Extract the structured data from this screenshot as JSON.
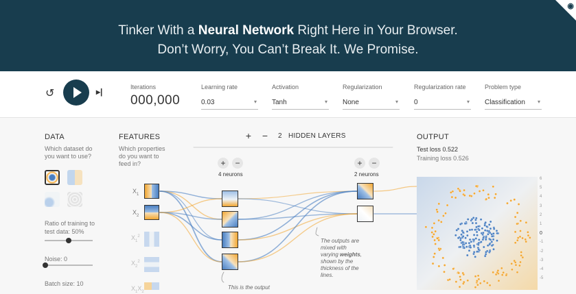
{
  "header": {
    "line1_pre": "Tinker With a ",
    "line1_bold": "Neural Network",
    "line1_post": " Right Here in Your Browser.",
    "line2": "Don’t Worry, You Can’t Break It. We Promise."
  },
  "controls": {
    "iterations_label": "Iterations",
    "iterations_value": "000,000",
    "learning_rate_label": "Learning rate",
    "learning_rate_value": "0.03",
    "activation_label": "Activation",
    "activation_value": "Tanh",
    "regularization_label": "Regularization",
    "regularization_value": "None",
    "regularization_rate_label": "Regularization rate",
    "regularization_rate_value": "0",
    "problem_type_label": "Problem type",
    "problem_type_value": "Classification"
  },
  "data_col": {
    "title": "DATA",
    "desc1": "Which dataset do",
    "desc2": "you want to use?",
    "ratio_label1": "Ratio of training to",
    "ratio_label2": "test data:  50%",
    "noise_label": "Noise:  0",
    "batch_label": "Batch size:  10",
    "ratio_value": 0.5,
    "noise_value": 0
  },
  "features_col": {
    "title": "FEATURES",
    "desc1": "Which properties",
    "desc2": "do you want to",
    "desc3": "feed in?"
  },
  "hidden": {
    "count": "2",
    "title": "HIDDEN LAYERS",
    "layer1_neurons": "4 neurons",
    "layer2_neurons": "2 neurons",
    "plus": "+",
    "minus": "−",
    "annot_weights": [
      "The outputs are",
      "mixed with",
      "varying weights,",
      "shown by the",
      "thickness of the",
      "lines."
    ],
    "annot_output": "This is the output"
  },
  "output": {
    "title": "OUTPUT",
    "test_loss": "Test loss 0.522",
    "training_loss": "Training loss 0.526",
    "ticks": [
      "6",
      "5",
      "4",
      "3",
      "2",
      "1",
      "0",
      "-1",
      "-2",
      "-3",
      "-4",
      "-5"
    ]
  },
  "colors": {
    "header_bg": "#183d4e",
    "positive": "#4a7fc1",
    "negative": "#f2a733"
  },
  "icons": {
    "reset": "reset-icon",
    "play": "play-icon",
    "step": "step-forward-icon",
    "github": "github-corner-icon"
  }
}
